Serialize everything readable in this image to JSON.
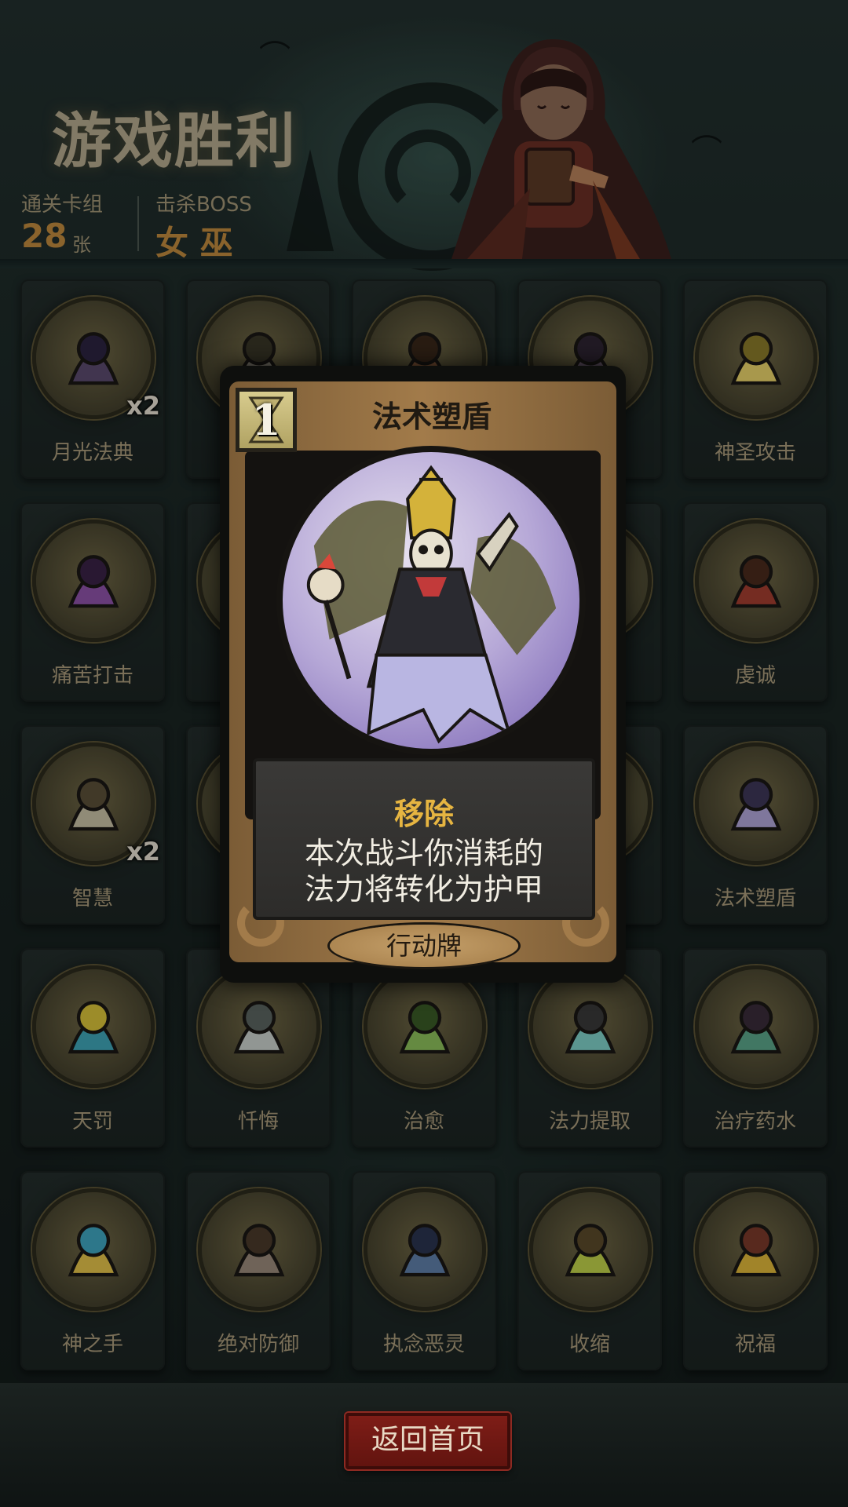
{
  "header": {
    "title": "游戏胜利",
    "deck_label": "通关卡组",
    "deck_count": "28",
    "deck_unit": "张",
    "boss_label": "击杀BOSS",
    "boss_name": "女 巫"
  },
  "cards": [
    {
      "name": "月光法典",
      "icon": "moonlight-tome",
      "multiplier": "x2"
    },
    {
      "name": "",
      "icon": "scythe"
    },
    {
      "name": "",
      "icon": "horn"
    },
    {
      "name": "",
      "icon": "skull-book"
    },
    {
      "name": "神圣攻击",
      "icon": "holy-strike"
    },
    {
      "name": "痛苦打击",
      "icon": "pain-strike"
    },
    {
      "name": "",
      "icon": "hidden"
    },
    {
      "name": "",
      "icon": "hidden"
    },
    {
      "name": "",
      "icon": "hidden"
    },
    {
      "name": "虔诚",
      "icon": "piety"
    },
    {
      "name": "智慧",
      "icon": "wisdom",
      "multiplier": "x2"
    },
    {
      "name": "",
      "icon": "hidden"
    },
    {
      "name": "",
      "icon": "hidden"
    },
    {
      "name": "",
      "icon": "hidden"
    },
    {
      "name": "法术塑盾",
      "icon": "spell-shield"
    },
    {
      "name": "天罚",
      "icon": "divine-punishment"
    },
    {
      "name": "忏悔",
      "icon": "repentance"
    },
    {
      "name": "治愈",
      "icon": "heal"
    },
    {
      "name": "法力提取",
      "icon": "mana-extract"
    },
    {
      "name": "治疗药水",
      "icon": "healing-potion"
    },
    {
      "name": "神之手",
      "icon": "hand-of-god"
    },
    {
      "name": "绝对防御",
      "icon": "absolute-defense"
    },
    {
      "name": "执念恶灵",
      "icon": "obsessed-ghost"
    },
    {
      "name": "收缩",
      "icon": "shrink"
    },
    {
      "name": "祝福",
      "icon": "blessing"
    }
  ],
  "popup": {
    "cost": "1",
    "title": "法术塑盾",
    "keyword": "移除",
    "desc_line1": "本次战斗你消耗的",
    "desc_line2": "法力将转化为护甲",
    "type": "行动牌"
  },
  "footer": {
    "home_button": "返回首页"
  },
  "colors": {
    "background": "#1b2624",
    "accent_gold": "#c08a3e",
    "keyword": "#e6b541",
    "button_red": "#7e1d17"
  }
}
